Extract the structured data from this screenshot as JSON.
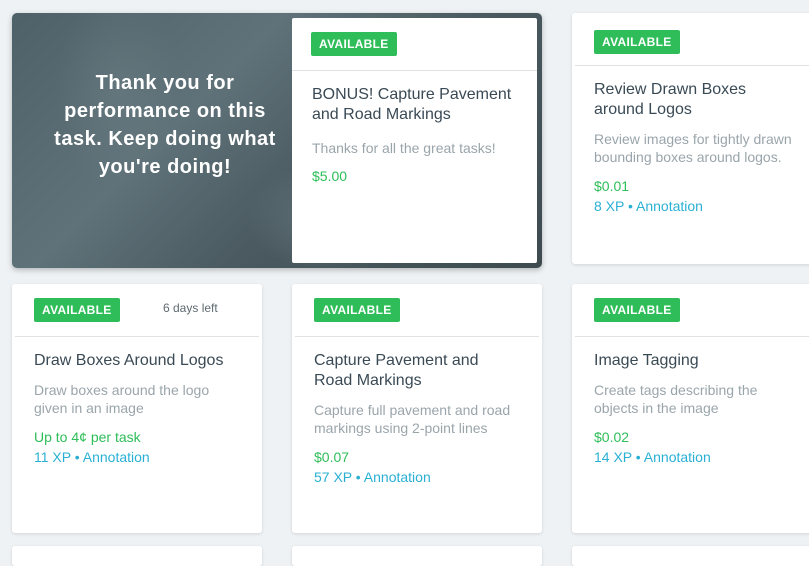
{
  "hero": {
    "message": "Thank you for performance on this task. Keep doing what you're doing!",
    "card": {
      "badge": "AVAILABLE",
      "title": "BONUS! Capture Pavement and Road Markings",
      "description": "Thanks for all the great tasks!",
      "price": "$5.00"
    }
  },
  "cards": [
    {
      "badge": "AVAILABLE",
      "title": "Review Drawn Boxes around Logos",
      "description": "Review images for tightly drawn bounding boxes around logos.",
      "price": "$0.01",
      "meta": "8 XP • Annotation"
    },
    {
      "badge": "AVAILABLE",
      "days_left": "6 days left",
      "title": "Draw Boxes Around Logos",
      "description": "Draw boxes around the logo given in an image",
      "price": "Up to 4¢ per task",
      "meta": "11 XP • Annotation"
    },
    {
      "badge": "AVAILABLE",
      "title": "Capture Pavement and Road Markings",
      "description": "Capture full pavement and road markings using 2-point lines",
      "price": "$0.07",
      "meta": "57 XP • Annotation"
    },
    {
      "badge": "AVAILABLE",
      "title": "Image Tagging",
      "description": "Create tags describing the objects in the image",
      "price": "$0.02",
      "meta": "14 XP • Annotation"
    }
  ],
  "colors": {
    "available_green": "#2ebd59",
    "link_blue": "#2ab0d4",
    "background": "#eef2f4"
  }
}
